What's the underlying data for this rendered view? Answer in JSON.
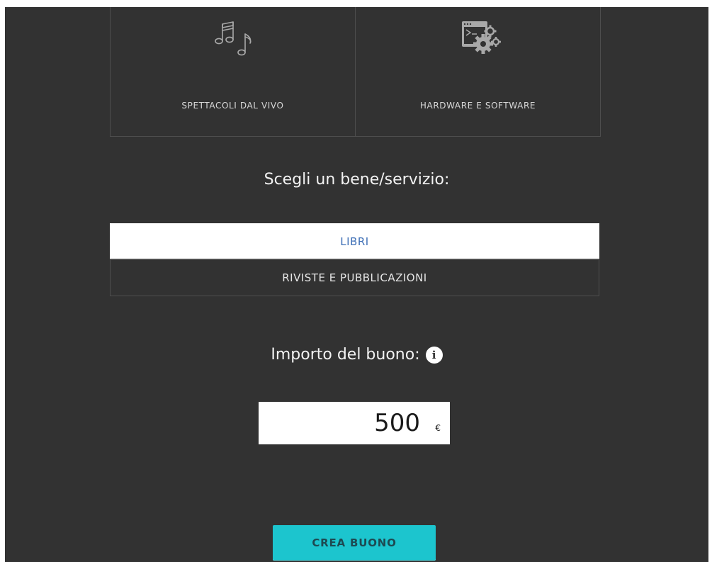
{
  "categories": [
    {
      "label": "SPETTACOLI DAL VIVO",
      "icon": "music-notes-icon"
    },
    {
      "label": "HARDWARE E SOFTWARE",
      "icon": "software-gears-icon"
    }
  ],
  "goods_heading": "Scegli un bene/servizio:",
  "options": [
    {
      "label": "LIBRI",
      "selected": true
    },
    {
      "label": "RIVISTE E PUBBLICAZIONI",
      "selected": false
    }
  ],
  "amount": {
    "heading": "Importo del buono:",
    "info_icon": "info-icon",
    "value": "500",
    "currency": "€"
  },
  "create_button_label": "CREA BUONO",
  "colors": {
    "background": "#323232",
    "selected_option_text": "#3e6fb6",
    "button": "#1cc5ce"
  }
}
